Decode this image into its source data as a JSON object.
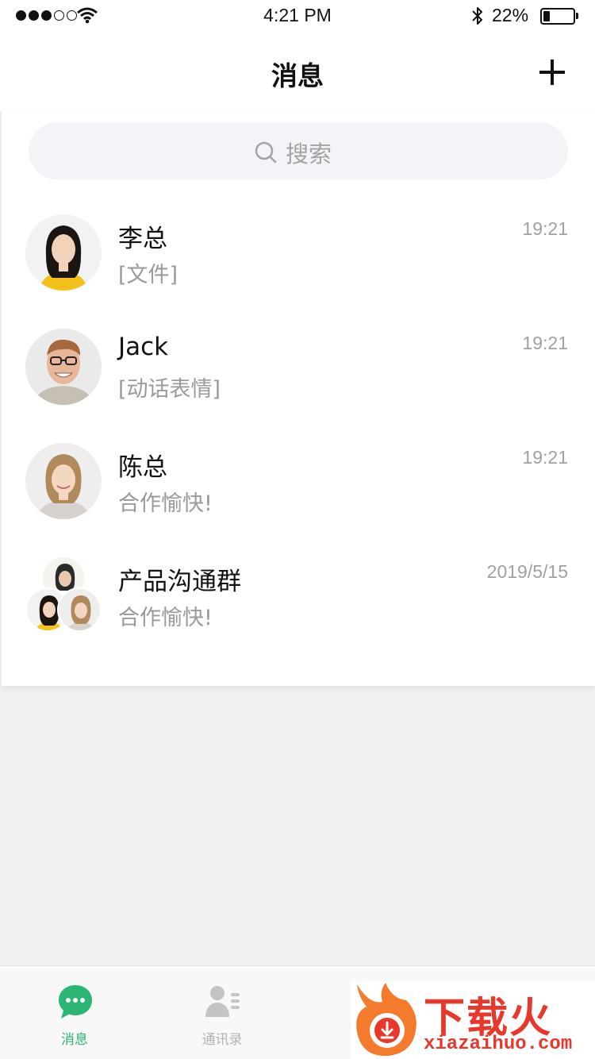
{
  "status_bar": {
    "time": "4:21 PM",
    "battery_percent": "22%",
    "battery_level": 0.22,
    "signal_bars_filled": 3,
    "signal_bars_total": 5
  },
  "nav": {
    "title": "消息",
    "add_icon": "plus-icon"
  },
  "search": {
    "placeholder": "搜索",
    "icon": "search-icon"
  },
  "chats": [
    {
      "name": "李总",
      "preview": "[文件]",
      "time": "19:21"
    },
    {
      "name": "Jack",
      "preview": "[动话表情]",
      "time": "19:21"
    },
    {
      "name": "陈总",
      "preview": "合作愉快!",
      "time": "19:21"
    },
    {
      "name": "产品沟通群",
      "preview": "合作愉快!",
      "time": "2019/5/15"
    }
  ],
  "tabs": [
    {
      "label": "消息",
      "icon": "chat-bubble-icon",
      "active": true
    },
    {
      "label": "通讯录",
      "icon": "contacts-icon",
      "active": false
    }
  ],
  "watermark": {
    "text": "下载火",
    "domain": "xiazaihuo.com"
  },
  "colors": {
    "accent": "#2bb673",
    "watermark": "#e8382c",
    "search_bg": "#f3f4f8"
  }
}
